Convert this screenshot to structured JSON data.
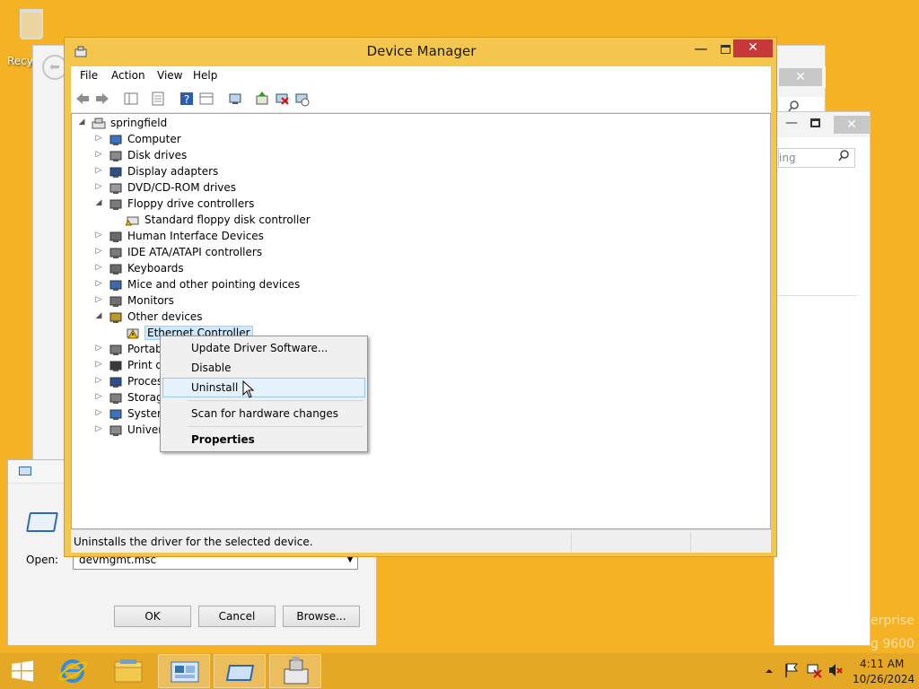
{
  "desktop": {
    "recycle_bin_label": "Recy"
  },
  "background": {
    "close_glyph": "✕",
    "search_placeholder": "ing",
    "watermark_line1": "erprise",
    "watermark_line2": "g 9600"
  },
  "run_dialog": {
    "open_label": "Open:",
    "open_value": "devmgmt.msc",
    "ok_label": "OK",
    "cancel_label": "Cancel",
    "browse_label": "Browse..."
  },
  "device_manager": {
    "title": "Device Manager",
    "close_glyph": "✕",
    "minimize_glyph": "—",
    "menu": [
      "File",
      "Action",
      "View",
      "Help"
    ],
    "tree": {
      "root": "springfield",
      "items": [
        {
          "label": "Computer",
          "expanded": false
        },
        {
          "label": "Disk drives",
          "expanded": false
        },
        {
          "label": "Display adapters",
          "expanded": false
        },
        {
          "label": "DVD/CD-ROM drives",
          "expanded": false
        },
        {
          "label": "Floppy drive controllers",
          "expanded": true
        },
        {
          "label": "Standard floppy disk controller",
          "child": true
        },
        {
          "label": "Human Interface Devices",
          "expanded": false
        },
        {
          "label": "IDE ATA/ATAPI controllers",
          "expanded": false
        },
        {
          "label": "Keyboards",
          "expanded": false
        },
        {
          "label": "Mice and other pointing devices",
          "expanded": false
        },
        {
          "label": "Monitors",
          "expanded": false
        },
        {
          "label": "Other devices",
          "expanded": true
        },
        {
          "label": "Ethernet Controller",
          "child": true,
          "selected": true
        },
        {
          "label": "Portab",
          "expanded": false
        },
        {
          "label": "Print q",
          "expanded": false
        },
        {
          "label": "Proces",
          "expanded": false
        },
        {
          "label": "Storag",
          "expanded": false
        },
        {
          "label": "System",
          "expanded": false
        },
        {
          "label": "Univer",
          "expanded": false
        }
      ]
    },
    "status_text": "Uninstalls the driver for the selected device."
  },
  "context_menu": {
    "items": [
      {
        "label": "Update Driver Software..."
      },
      {
        "label": "Disable"
      },
      {
        "label": "Uninstall",
        "hovered": true
      },
      {
        "label": "Scan for hardware changes"
      },
      {
        "label": "Properties",
        "bold": true
      }
    ]
  },
  "taskbar": {
    "time": "4:11 AM",
    "date": "10/26/2024"
  },
  "colors": {
    "desktop": "#f5b225",
    "window_frame": "#f5c64d",
    "close_button": "#c7383a",
    "taskbar": "#e4a726",
    "selection": "#cde8ff"
  }
}
